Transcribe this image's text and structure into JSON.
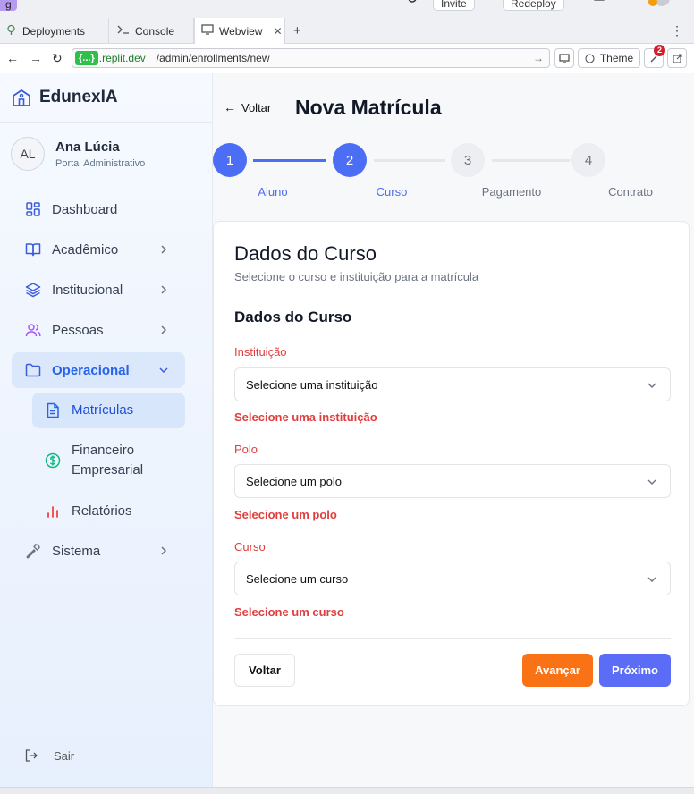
{
  "top": {
    "tag": "g",
    "invite_label": "Invite",
    "redeploy_label": "Redeploy"
  },
  "tabs": [
    {
      "label": "Deployments",
      "icon": "deploy-icon"
    },
    {
      "label": "Console",
      "icon": "terminal-icon"
    },
    {
      "label": "Webview",
      "icon": "monitor-icon",
      "active": true
    }
  ],
  "address": {
    "chip": "{...}",
    "host": ".replit.dev",
    "path": "/admin/enrollments/new",
    "theme_label": "Theme",
    "badge_count": "2"
  },
  "sidebar": {
    "brand": "EdunexIA",
    "user": {
      "initials": "AL",
      "name": "Ana Lúcia",
      "role": "Portal Administrativo"
    },
    "items": [
      {
        "label": "Dashboard"
      },
      {
        "label": "Acadêmico"
      },
      {
        "label": "Institucional"
      },
      {
        "label": "Pessoas"
      },
      {
        "label": "Operacional"
      },
      {
        "label": "Sistema"
      }
    ],
    "subitems": [
      {
        "label": "Matrículas"
      },
      {
        "label": "Financeiro Empresarial"
      },
      {
        "label": "Relatórios"
      }
    ],
    "logout_label": "Sair"
  },
  "main": {
    "back_label": "Voltar",
    "page_title": "Nova Matrícula",
    "steps": [
      {
        "number": "1",
        "label": "Aluno"
      },
      {
        "number": "2",
        "label": "Curso"
      },
      {
        "number": "3",
        "label": "Pagamento"
      },
      {
        "number": "4",
        "label": "Contrato"
      }
    ],
    "card": {
      "title": "Dados do Curso",
      "subtitle": "Selecione o curso e instituição para a matrícula",
      "section_title": "Dados do Curso",
      "fields": [
        {
          "label": "Instituição",
          "value": "Selecione uma instituição",
          "error": "Selecione uma instituição"
        },
        {
          "label": "Polo",
          "value": "Selecione um polo",
          "error": "Selecione um polo"
        },
        {
          "label": "Curso",
          "value": "Selecione um curso",
          "error": "Selecione um curso"
        }
      ],
      "back_button": "Voltar",
      "advance_button": "Avançar",
      "next_button": "Próximo"
    }
  },
  "colors": {
    "primary": "#4c6ef5",
    "error": "#e03e3e",
    "orange": "#f97316"
  }
}
